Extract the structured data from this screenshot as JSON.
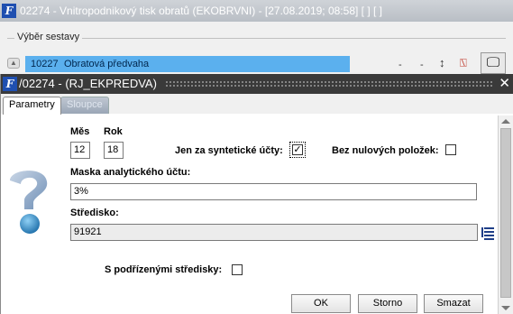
{
  "background_window": {
    "title": "02274 - Vnitropodnikový tisk obratů (EKOBRVNI) - [27.08.2019; 08:58]  [ ]  [ ]",
    "group_label": "Výběr sestavy",
    "row": {
      "code": "10227",
      "name": "Obratová předvaha"
    },
    "dash1": "-",
    "dash2": "-",
    "sort_icon_glyph": "↕",
    "pdf_icon_glyph": "⍂",
    "monitor_icon_glyph": "🖵"
  },
  "dialog": {
    "title": "/02274 - (RJ_EKPREDVA)",
    "close_glyph": "✕",
    "tabs": [
      {
        "label": "Parametry",
        "active": true
      },
      {
        "label": "Sloupce",
        "active": false
      }
    ],
    "month": {
      "label": "Měs",
      "value": "12"
    },
    "year": {
      "label": "Rok",
      "value": "18"
    },
    "synthetic_only": {
      "label": "Jen za syntetické účty:",
      "checked": true,
      "glyph": "✓"
    },
    "no_zero_items": {
      "label": "Bez nulových položek:",
      "checked": false
    },
    "analytic_mask": {
      "label": "Maska analytického účtu:",
      "value": "3%"
    },
    "cost_center": {
      "label": "Středisko:",
      "value": "91921"
    },
    "with_sub_centers": {
      "label": "S podřízenými středisky:",
      "checked": false
    },
    "buttons": {
      "ok": "OK",
      "cancel": "Storno",
      "clear": "Smazat"
    }
  },
  "colors": {
    "selected_row": "#5bb0ee",
    "dialog_titlebar": "#3a3a3a",
    "icon_blue": "#1f4fb0"
  }
}
